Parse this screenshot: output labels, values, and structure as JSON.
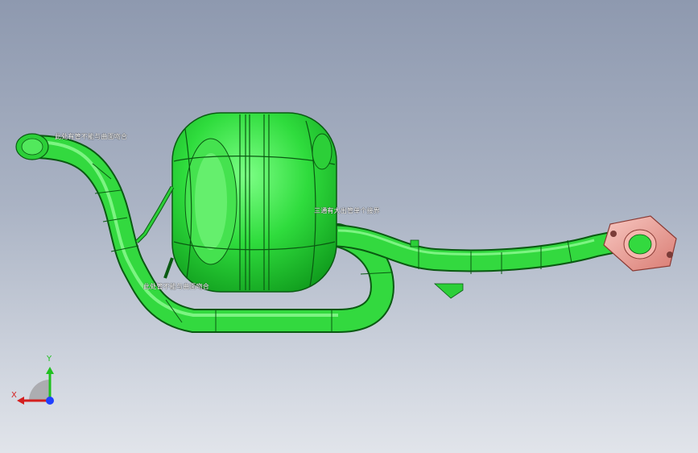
{
  "annotations": {
    "inlet_note": "此处有管不能与曲面吻合",
    "lower_note": "此处管不能与曲面吻合",
    "outlet_note": "三通有大出管单个接界"
  },
  "triad": {
    "x_label": "X",
    "y_label": "Y",
    "x_color": "#d42020",
    "y_color": "#20c020",
    "z_color": "#2040ff"
  },
  "model": {
    "body_color": "#2edb3c",
    "edge_color": "#0a5a12",
    "flange_color": "#f2a9a2"
  }
}
